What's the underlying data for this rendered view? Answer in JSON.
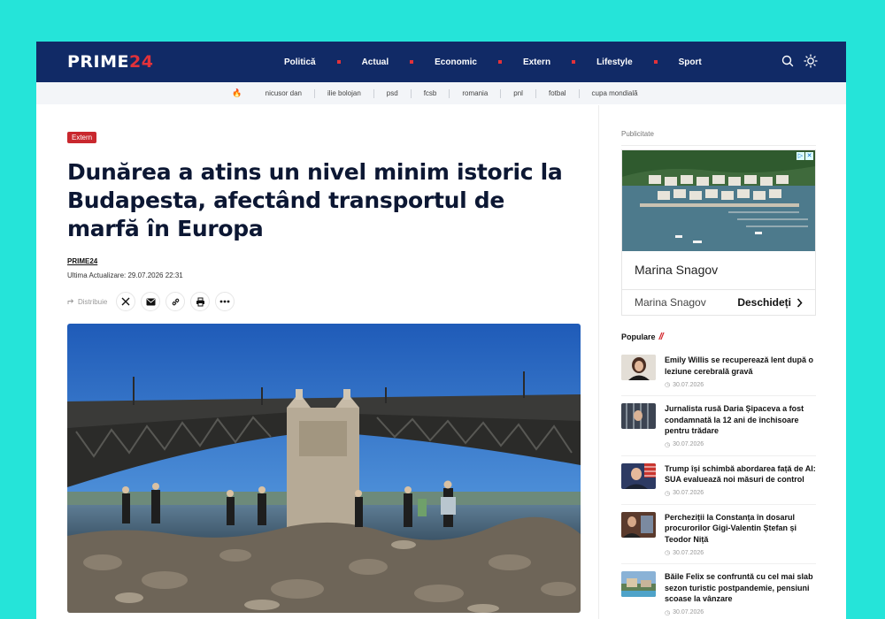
{
  "header": {
    "logo_main": "PRIME",
    "logo_accent": "24",
    "nav": [
      "Politică",
      "Actual",
      "Economic",
      "Extern",
      "Lifestyle",
      "Sport"
    ],
    "icons": [
      "search-icon",
      "sun-icon"
    ]
  },
  "tags": [
    "nicusor dan",
    "ilie bolojan",
    "psd",
    "fcsb",
    "romania",
    "pnl",
    "fotbal",
    "cupa mondială"
  ],
  "article": {
    "category": "Extern",
    "title": "Dunărea a atins un nivel minim istoric la Budapesta, afectând transportul de marfă în Europa",
    "author": "PRIME24",
    "updated": "Ultima Actualizare: 29.07.2026 22:31",
    "share_label": "Distribuie",
    "share_icons": [
      "x-icon",
      "mail-icon",
      "link-icon",
      "print-icon",
      "more-icon"
    ]
  },
  "sidebar": {
    "ad_label": "Publicitate",
    "ad_title": "Marina Snagov",
    "ad_sub": "Marina Snagov",
    "ad_cta": "Deschideți",
    "popular_title": "Populare",
    "popular_mark": "//",
    "popular": [
      {
        "title": "Emily Willis se recuperează lent după o leziune cerebrală gravă",
        "date": "30.07.2026"
      },
      {
        "title": "Jurnalista rusă Daria Șipaceva a fost condamnată la 12 ani de închisoare pentru trădare",
        "date": "30.07.2026"
      },
      {
        "title": "Trump își schimbă abordarea față de AI: SUA evaluează noi măsuri de control",
        "date": "30.07.2026"
      },
      {
        "title": "Percheziții la Constanța în dosarul procurorilor Gigi-Valentin Ștefan și Teodor Niță",
        "date": "30.07.2026"
      },
      {
        "title": "Băile Felix se confruntă cu cel mai slab sezon turistic postpandemie, pensiuni scoase la vânzare",
        "date": "30.07.2026"
      }
    ]
  },
  "colors": {
    "header_bg": "#112a66",
    "accent_red": "#e2323a",
    "category_bg": "#c9282e",
    "background": "#25e4d9"
  }
}
